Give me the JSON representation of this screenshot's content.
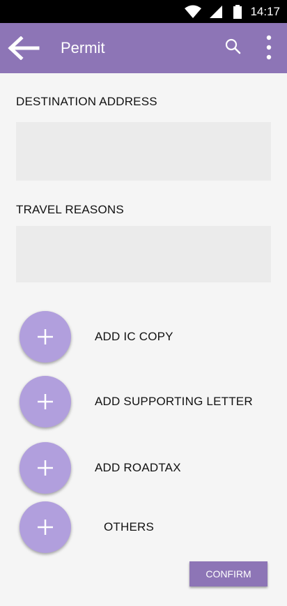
{
  "status_bar": {
    "time": "14:17",
    "icons": [
      "wifi-icon",
      "cell-signal-icon",
      "battery-icon"
    ]
  },
  "app_bar": {
    "title": "Permit",
    "icons": [
      "back-arrow-icon",
      "search-icon",
      "more-vert-icon"
    ]
  },
  "form": {
    "destination_label": "DESTINATION ADDRESS",
    "destination_value": "",
    "reasons_label": "TRAVEL REASONS",
    "reasons_value": ""
  },
  "attachments": [
    {
      "label": "ADD IC COPY",
      "icon": "plus-icon"
    },
    {
      "label": "ADD SUPPORTING LETTER",
      "icon": "plus-icon"
    },
    {
      "label": "ADD ROADTAX",
      "icon": "plus-icon"
    },
    {
      "label": "OTHERS",
      "icon": "plus-icon"
    }
  ],
  "confirm_label": "CONFIRM",
  "colors": {
    "app_bar": "#8d75b6",
    "add_button": "#b19fdd",
    "input_bg": "#ebebeb",
    "background": "#f5f5f5"
  }
}
